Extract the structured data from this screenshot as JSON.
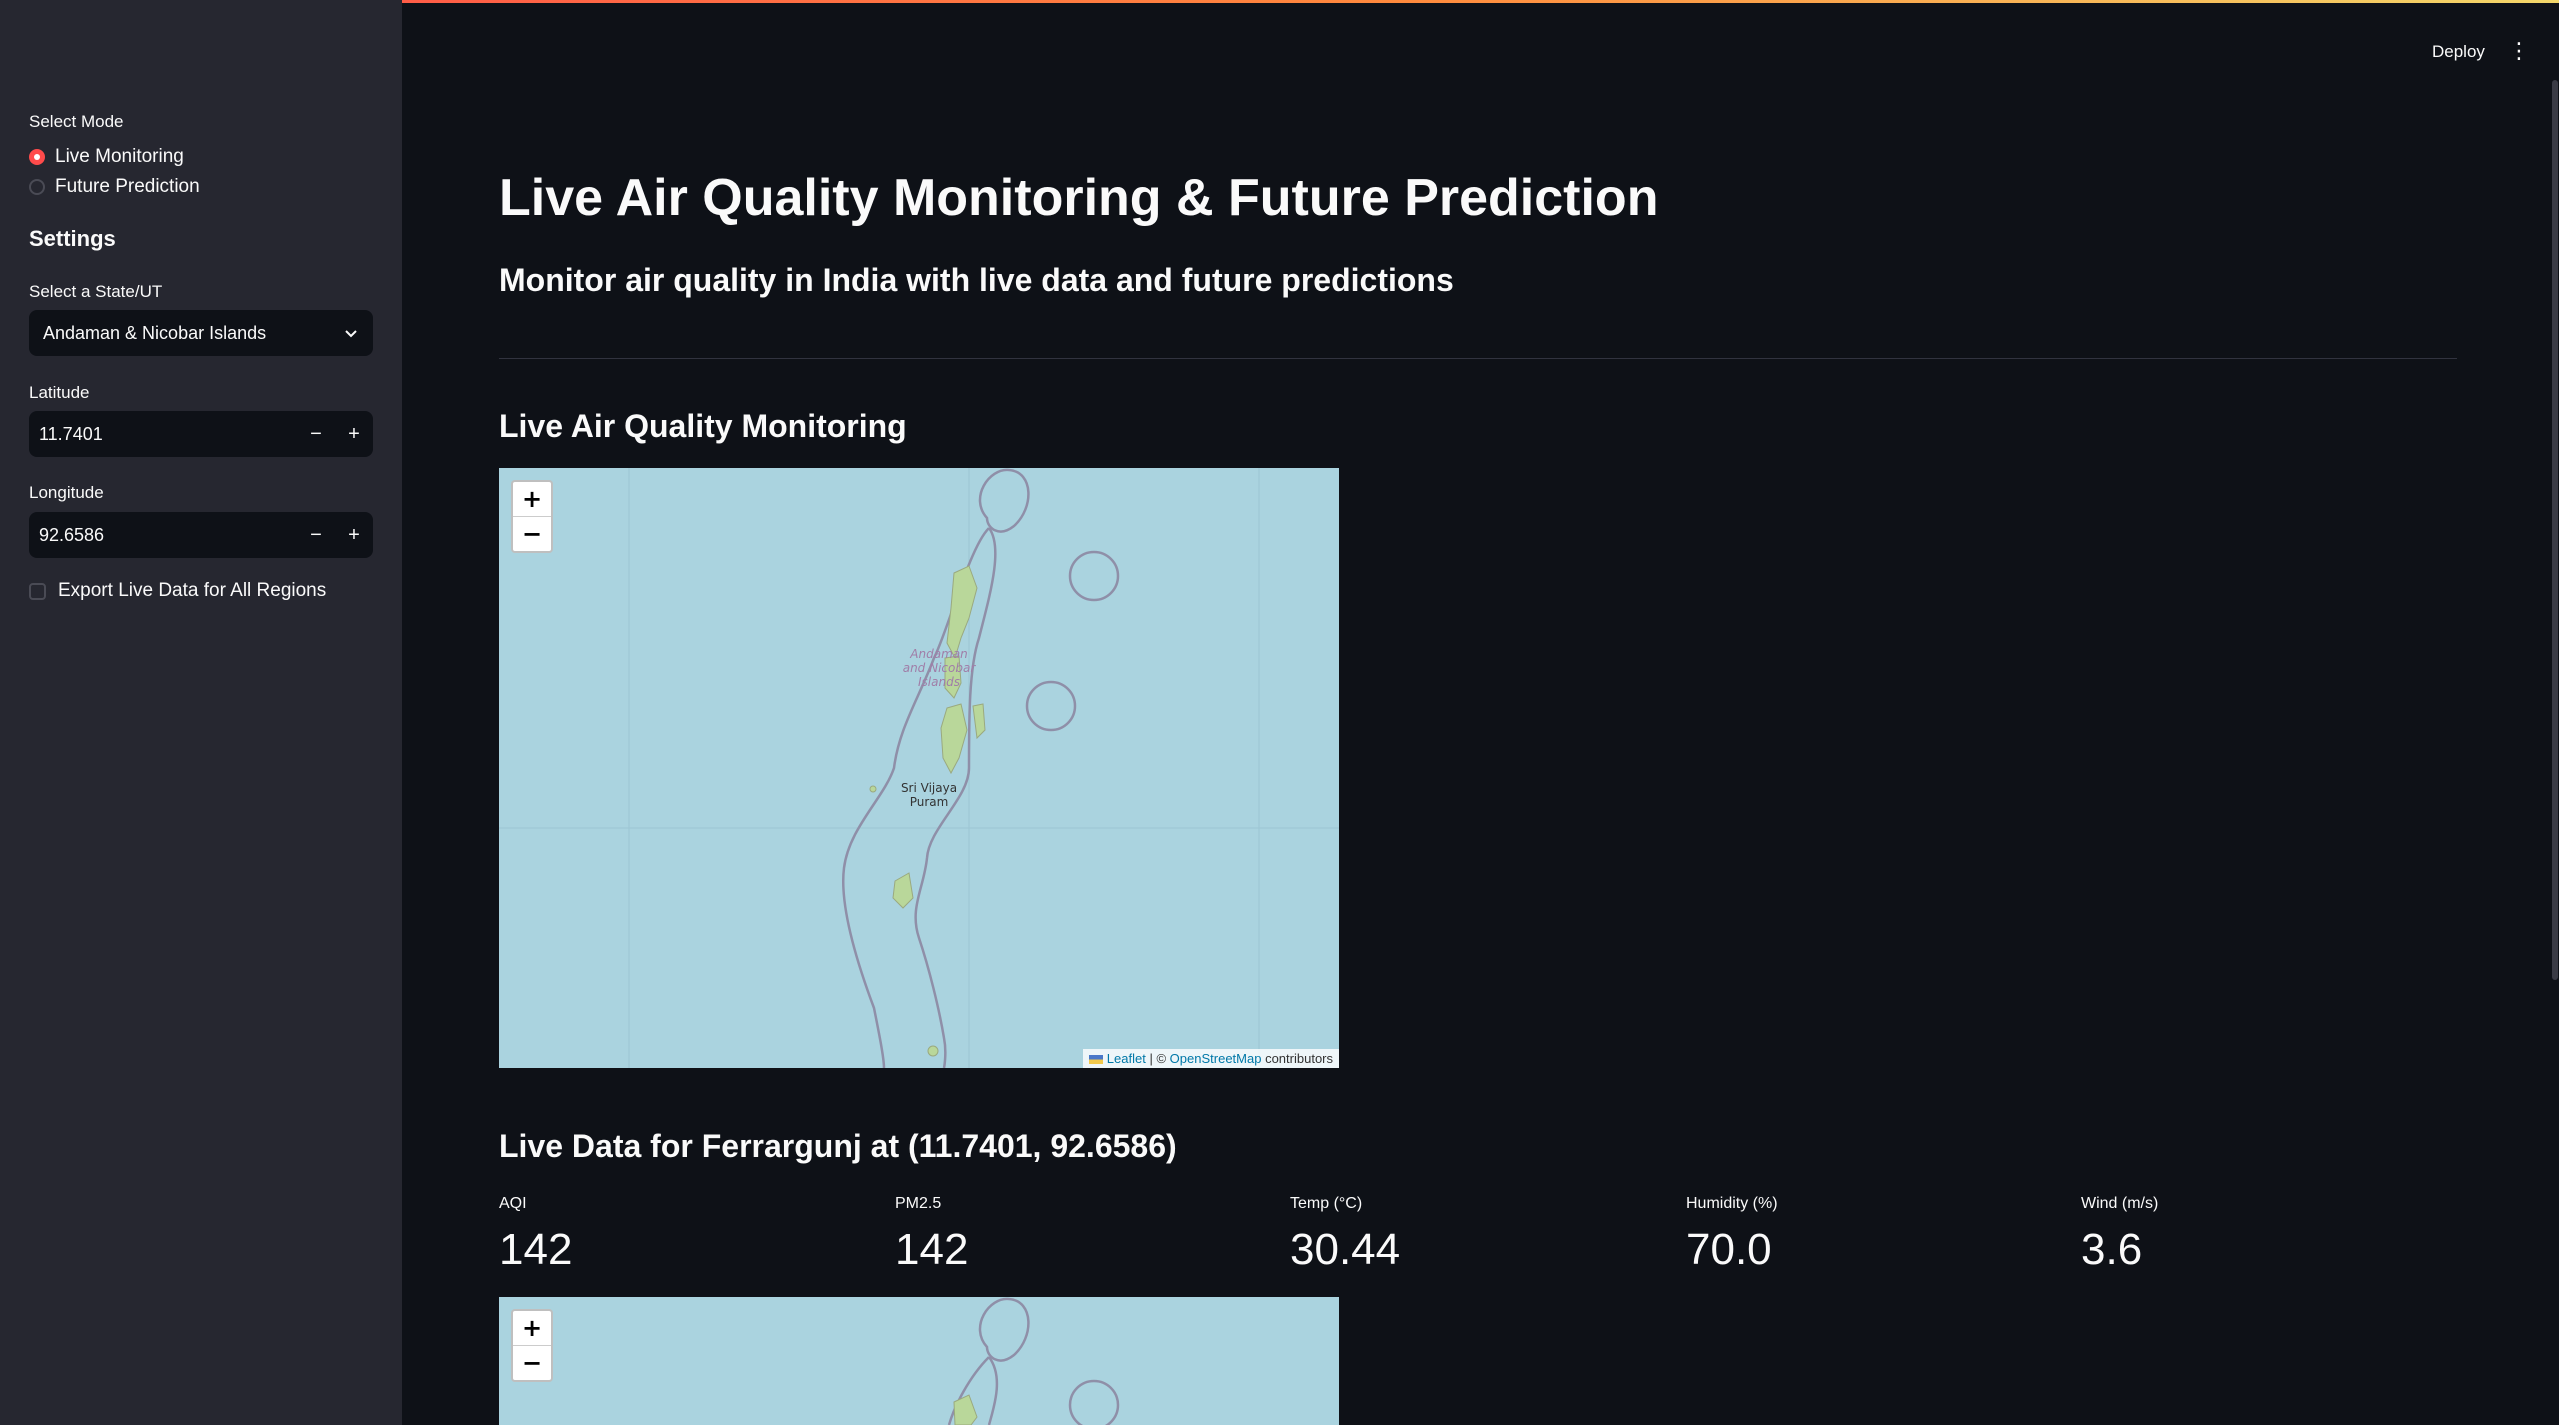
{
  "sidebar": {
    "mode_label": "Select Mode",
    "modes": [
      {
        "label": "Live Monitoring",
        "selected": true
      },
      {
        "label": "Future Prediction",
        "selected": false
      }
    ],
    "settings_heading": "Settings",
    "state_label": "Select a State/UT",
    "state_value": "Andaman & Nicobar Islands",
    "latitude_label": "Latitude",
    "latitude_value": "11.7401",
    "longitude_label": "Longitude",
    "longitude_value": "92.6586",
    "stepper_minus": "−",
    "stepper_plus": "+",
    "export_label": "Export Live Data for All Regions",
    "export_checked": false
  },
  "header": {
    "deploy_label": "Deploy",
    "menu_icon": "kebab-menu-icon"
  },
  "main": {
    "title": "Live Air Quality Monitoring & Future Prediction",
    "subtitle": "Monitor air quality in India with live data and future predictions",
    "live_section_title": "Live Air Quality Monitoring",
    "map": {
      "zoom_in": "+",
      "zoom_out": "−",
      "place_label_lines": [
        "Andaman",
        "and Nicobar",
        "Islands"
      ],
      "city_label_lines": [
        "Sri Vijaya",
        "Puram"
      ],
      "attribution_leaflet": "Leaflet",
      "attribution_sep": "| ©",
      "attribution_osm": "OpenStreetMap",
      "attribution_suffix": "contributors"
    },
    "live_data_title": "Live Data for Ferrargunj at (11.7401, 92.6586)",
    "metrics": [
      {
        "label": "AQI",
        "value": "142"
      },
      {
        "label": "PM2.5",
        "value": "142"
      },
      {
        "label": "Temp (°C)",
        "value": "30.44"
      },
      {
        "label": "Humidity (%)",
        "value": "70.0"
      },
      {
        "label": "Wind (m/s)",
        "value": "3.6"
      }
    ]
  },
  "colors": {
    "accent": "#ff4b4b",
    "background": "#0e1117",
    "sidebar": "#262730",
    "map_water": "#aad3df"
  }
}
